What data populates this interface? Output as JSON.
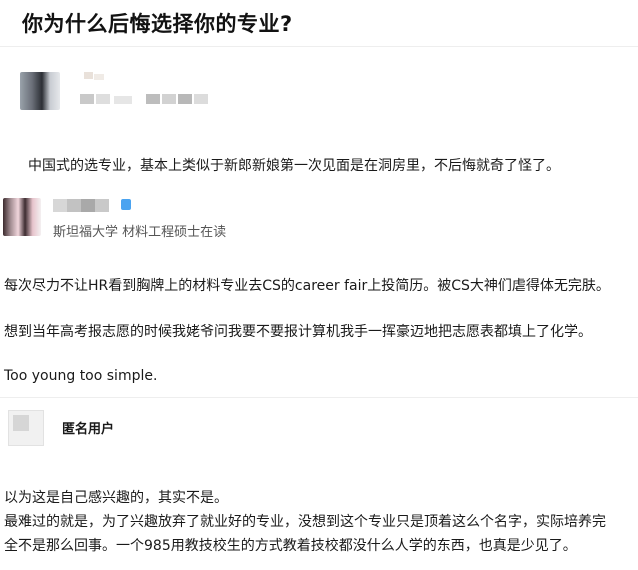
{
  "question": {
    "title": "你为什么后悔选择你的专业?"
  },
  "answers": [
    {
      "author_name_visible": false,
      "content": [
        "中国式的选专业，基本上类似于新郎新娘第一次见面是在洞房里，不后悔就奇了怪了。"
      ]
    },
    {
      "author_bio": "斯坦福大学 材料工程硕士在读",
      "verified_badge_color": "#4aa3f0",
      "content": [
        "每次尽力不让HR看到胸牌上的材料专业去CS的career fair上投简历。被CS大神们虐得体无完肤。",
        "想到当年高考报志愿的时候我姥爷问我要不要报计算机我手一挥豪迈地把志愿表都填上了化学。",
        "Too young too simple."
      ]
    },
    {
      "author_name": "匿名用户",
      "content": [
        "以为这是自己感兴趣的，其实不是。",
        "最难过的就是，为了兴趣放弃了就业好的专业，没想到这个专业只是顶着这么个名字，实际培养完",
        "全不是那么回事。一个985用教技校生的方式教着技校都没什么人学的东西，也真是少见了。"
      ]
    }
  ]
}
